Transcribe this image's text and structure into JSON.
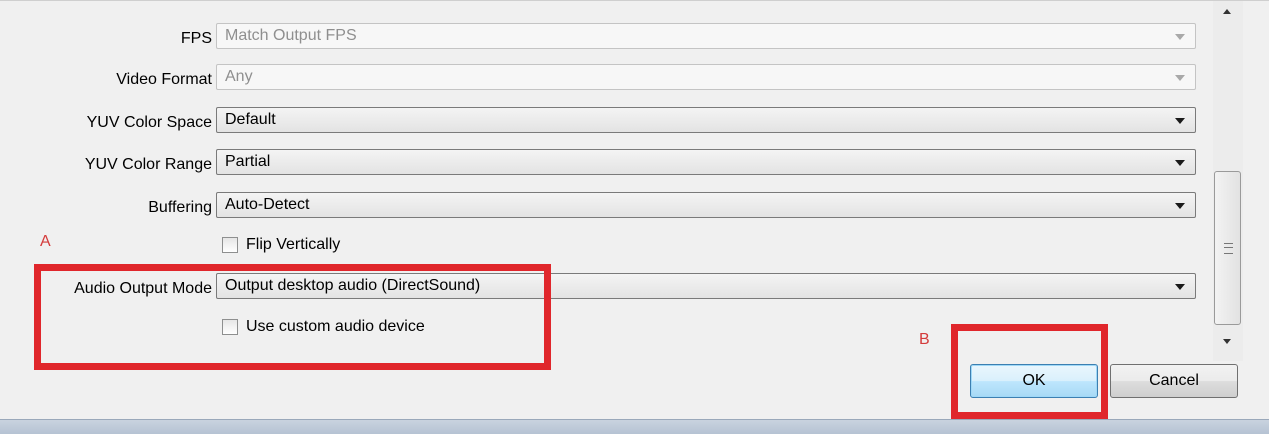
{
  "fields": {
    "fps": {
      "label": "FPS",
      "value": "Match Output FPS"
    },
    "video_format": {
      "label": "Video Format",
      "value": "Any"
    },
    "yuv_color_space": {
      "label": "YUV Color Space",
      "value": "Default"
    },
    "yuv_color_range": {
      "label": "YUV Color Range",
      "value": "Partial"
    },
    "buffering": {
      "label": "Buffering",
      "value": "Auto-Detect"
    },
    "audio_output_mode": {
      "label": "Audio Output Mode",
      "value": "Output desktop audio (DirectSound)"
    }
  },
  "checkboxes": {
    "flip_vertically": {
      "label": "Flip Vertically",
      "checked": false
    },
    "use_custom_audio_device": {
      "label": "Use custom audio device",
      "checked": false
    }
  },
  "annotations": {
    "a": "A",
    "b": "B",
    "color": "#e0262b"
  },
  "buttons": {
    "ok": "OK",
    "cancel": "Cancel"
  }
}
